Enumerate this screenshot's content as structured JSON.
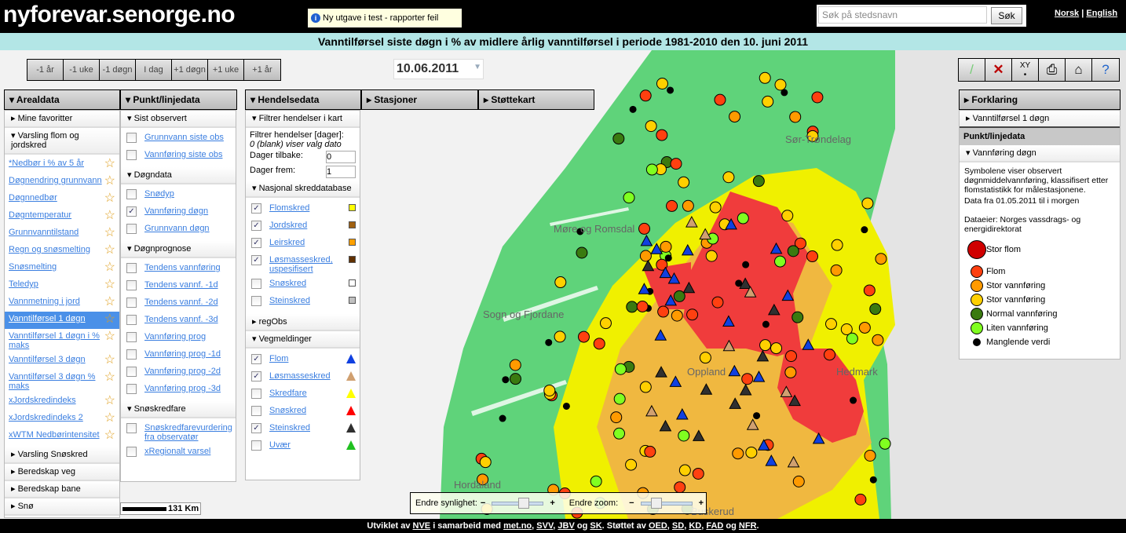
{
  "header": {
    "logo": "nyforevar.senorge.no",
    "test_note": "Ny utgave i test - rapporter feil",
    "search_placeholder": "Søk på stedsnavn",
    "search_button": "Søk",
    "lang": [
      "Norsk",
      "English"
    ]
  },
  "title": "Vanntilførsel siste døgn i % av midlere årlig vanntilførsel i periode 1981-2010  den 10. juni 2011",
  "nav_buttons": [
    "-1 år",
    "-1 uke",
    "-1 døgn",
    "I dag",
    "+1 døgn",
    "+1 uke",
    "+1 år"
  ],
  "date": "10.06.2011",
  "tools": [
    "draw-icon",
    "delete-icon",
    "coordinates-icon",
    "print-icon",
    "home-icon",
    "help-icon"
  ],
  "tabs": {
    "arealdata": "Arealdata",
    "punkt": "Punkt/linjedata",
    "hendelse": "Hendelsedata",
    "stasjoner": "Stasjoner",
    "stottekart": "Støttekart",
    "forklaring": "Forklaring"
  },
  "arealdata": {
    "favoritter": "Mine favoritter",
    "varsling": "Varsling flom og jordskred",
    "items": [
      "*Nedbør i % av 5 år",
      "Døgnendring grunnvann",
      "Døgnnedbør",
      "Døgntemperatur",
      "Grunnvanntilstand",
      "Regn og snøsmelting",
      "Snøsmelting",
      "Teledyp",
      "Vannmetning i jord",
      "Vanntilførsel 1 døgn",
      "Vanntilførsel 1 døgn i % maks",
      "Vanntilførsel 3 døgn",
      "Vanntilførsel 3 døgn % maks",
      "xJordskredindeks",
      "xJordskredindeks 2",
      "xWTM Nedbørintensitet"
    ],
    "selected": "Vanntilførsel 1 døgn",
    "sections": [
      "Varsling Snøskred",
      "Beredskap veg",
      "Beredskap bane",
      "Snø"
    ]
  },
  "punkt": {
    "groups": [
      {
        "title": "Sist observert",
        "items": [
          {
            "label": "Grunnvann siste obs",
            "checked": false
          },
          {
            "label": "Vannføring siste obs",
            "checked": false
          }
        ]
      },
      {
        "title": "Døgndata",
        "items": [
          {
            "label": "Snødyp",
            "checked": false
          },
          {
            "label": "Vannføring døgn",
            "checked": true
          },
          {
            "label": "Grunnvann døgn",
            "checked": false
          }
        ]
      },
      {
        "title": "Døgnprognose",
        "items": [
          {
            "label": "Tendens vannføring",
            "checked": false
          },
          {
            "label": "Tendens vannf. -1d",
            "checked": false
          },
          {
            "label": "Tendens vannf. -2d",
            "checked": false
          },
          {
            "label": "Tendens vannf. -3d",
            "checked": false
          },
          {
            "label": "Vannføring prog",
            "checked": false
          },
          {
            "label": "Vannføring prog -1d",
            "checked": false
          },
          {
            "label": "Vannføring prog -2d",
            "checked": false
          },
          {
            "label": "Vannføring prog -3d",
            "checked": false
          }
        ]
      },
      {
        "title": "Snøskredfare",
        "items": [
          {
            "label": "Snøskredfarevurdering fra observatør",
            "checked": false
          },
          {
            "label": "xRegionalt varsel",
            "checked": false
          }
        ]
      }
    ]
  },
  "hendelse": {
    "filter_title": "Filtrer hendelser i kart",
    "filter_label": "Filtrer hendelser [dager]:",
    "filter_hint": "0 (blank) viser valg dato",
    "dager_tilbake_label": "Dager tilbake:",
    "dager_tilbake": "0",
    "dager_frem_label": "Dager frem:",
    "dager_frem": "1",
    "nasjonal_title": "Nasjonal skreddatabase",
    "nasjonal": [
      {
        "label": "Flomskred",
        "checked": true,
        "color": "#ffff00"
      },
      {
        "label": "Jordskred",
        "checked": true,
        "color": "#a06010"
      },
      {
        "label": "Leirskred",
        "checked": true,
        "color": "#ffa000"
      },
      {
        "label": "Løsmasseskred, uspesifisert",
        "checked": true,
        "color": "#603000"
      },
      {
        "label": "Snøskred",
        "checked": false,
        "color": "#ffffff"
      },
      {
        "label": "Steinskred",
        "checked": false,
        "color": "#c0c0c0"
      }
    ],
    "regobs": "regObs",
    "veg_title": "Vegmeldinger",
    "veg": [
      {
        "label": "Flom",
        "checked": true,
        "color": "#1040e0"
      },
      {
        "label": "Løsmasseskred",
        "checked": true,
        "color": "#d0a070"
      },
      {
        "label": "Skredfare",
        "checked": false,
        "color": "#ffff00"
      },
      {
        "label": "Snøskred",
        "checked": false,
        "color": "#ff0000"
      },
      {
        "label": "Steinskred",
        "checked": true,
        "color": "#303030"
      },
      {
        "label": "Uvær",
        "checked": false,
        "color": "#20c020"
      }
    ]
  },
  "forklaring": {
    "area": "Vanntilførsel 1 døgn",
    "punkt_title": "Punkt/linjedata",
    "vannforing": "Vannføring døgn",
    "desc": "Symbolene viser observert døgnmiddelvannføring, klassifisert etter flomstatistikk for målestasjonene.",
    "period": "Data fra 01.05.2011 til i morgen",
    "owner": "Dataeier: Norges vassdrags- og energidirektorat",
    "legend": [
      {
        "label": "Stor flom",
        "color": "#d00000"
      },
      {
        "label": "Flom",
        "color": "#ff4010"
      },
      {
        "label": "Stor vannføring",
        "color": "#ff9a00"
      },
      {
        "label": "Stor vannføring",
        "color": "#ffd000"
      },
      {
        "label": "Normal vannføring",
        "color": "#3a7a10"
      },
      {
        "label": "Liten vannføring",
        "color": "#80ff20"
      },
      {
        "label": "Manglende verdi",
        "color": "#000000"
      }
    ]
  },
  "map": {
    "regions": [
      "Sør-Trøndelag",
      "Møre og Romsdal",
      "Sogn og Fjordane",
      "Oppland",
      "Hedmark",
      "Hordaland",
      "Buskerud"
    ],
    "scale": "131 Km",
    "opacity_label": "Endre synlighet:",
    "zoom_label": "Endre zoom:",
    "opacity": 0.6,
    "zoom": 0.3
  },
  "footer": {
    "parts": [
      "Utviklet av ",
      "NVE",
      " i samarbeid med ",
      "met.no",
      ", ",
      "SVV",
      ", ",
      "JBV",
      " og ",
      "SK",
      ". Støttet av ",
      "OED",
      ", ",
      "SD",
      ", ",
      "KD",
      ", ",
      "FAD",
      " og ",
      "NFR",
      "."
    ]
  }
}
